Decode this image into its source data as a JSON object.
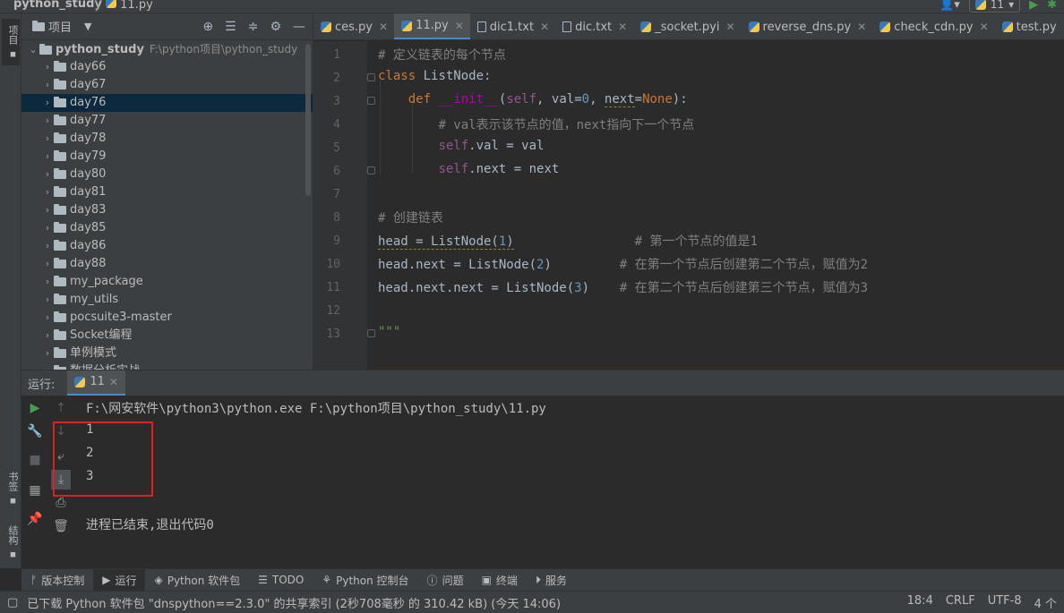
{
  "titlebar": {
    "project": "python_study",
    "separator": "〉",
    "file": "11.py",
    "run_config": "11"
  },
  "left_strip": {
    "project_tab": "项目",
    "bookmarks_tab": "书签",
    "structure_tab": "结构"
  },
  "project_panel": {
    "title": "项目",
    "root": {
      "name": "python_study",
      "path": "F:\\python项目\\python_study"
    },
    "items": [
      "day66",
      "day67",
      "day76",
      "day77",
      "day78",
      "day79",
      "day80",
      "day81",
      "day83",
      "day85",
      "day86",
      "day88",
      "my_package",
      "my_utils",
      "pocsuite3-master",
      "Socket编程",
      "单例模式",
      "数据分析实战"
    ],
    "selected": "day76"
  },
  "tabs": [
    "ces.py",
    "11.py",
    "dic1.txt",
    "dic.txt",
    "_socket.pyi",
    "reverse_dns.py",
    "check_cdn.py",
    "test.py"
  ],
  "active_tab": "11.py",
  "editor": {
    "line_numbers": [
      "1",
      "2",
      "3",
      "4",
      "5",
      "6",
      "7",
      "8",
      "9",
      "10",
      "11",
      "12",
      "13"
    ],
    "comment1": "# 定义链表的每个节点",
    "kw_class": "class",
    "classname": " ListNode:",
    "kw_def": "def",
    "init": "__init__",
    "p_open": "(",
    "self1": "self",
    "p_val": ", val=",
    "zero": "0",
    "p_next": ", ",
    "next_param": "next",
    "p_eq": "=",
    "none": "None",
    "p_close": "):",
    "comment2": "# val表示该节点的值，next指向下一个节点",
    "self2": "self",
    "line5_rest": ".val = val",
    "self3": "self",
    "line6_rest": ".next = next",
    "comment3": "# 创建链表",
    "l9_code_a": "head = ListNode(",
    "one": "1",
    "l9_code_b": ")",
    "l9_comment": "# 第一个节点的值是1",
    "l10_code_a": "head.next = ListNode(",
    "two": "2",
    "l10_code_b": ")",
    "l10_comment": "# 在第一个节点后创建第二个节点，赋值为2",
    "l11_code_a": "head.next.next = ListNode(",
    "three": "3",
    "l11_code_b": ")",
    "l11_comment": "# 在第二个节点后创建第三个节点，赋值为3",
    "l13": "\"\"\""
  },
  "run": {
    "label": "运行:",
    "tab": "11",
    "command": "F:\\网安软件\\python3\\python.exe F:\\python项目\\python_study\\11.py",
    "output": [
      "1",
      "2",
      "3"
    ],
    "exit": "进程已结束,退出代码0"
  },
  "tool_tabs": [
    "版本控制",
    "运行",
    "Python 软件包",
    "TODO",
    "Python 控制台",
    "问题",
    "终端",
    "服务"
  ],
  "status": {
    "message": "已下载 Python 软件包 \"dnspython==2.3.0\" 的共享索引 (2秒708毫秒 的 310.42 kB) (今天 14:06)",
    "position": "18:4",
    "line_sep": "CRLF",
    "encoding": "UTF-8",
    "indent": "4 个"
  },
  "colors": {
    "accent": "#4a88c7",
    "highlight_box": "#e02020",
    "run_green": "#499c54"
  }
}
